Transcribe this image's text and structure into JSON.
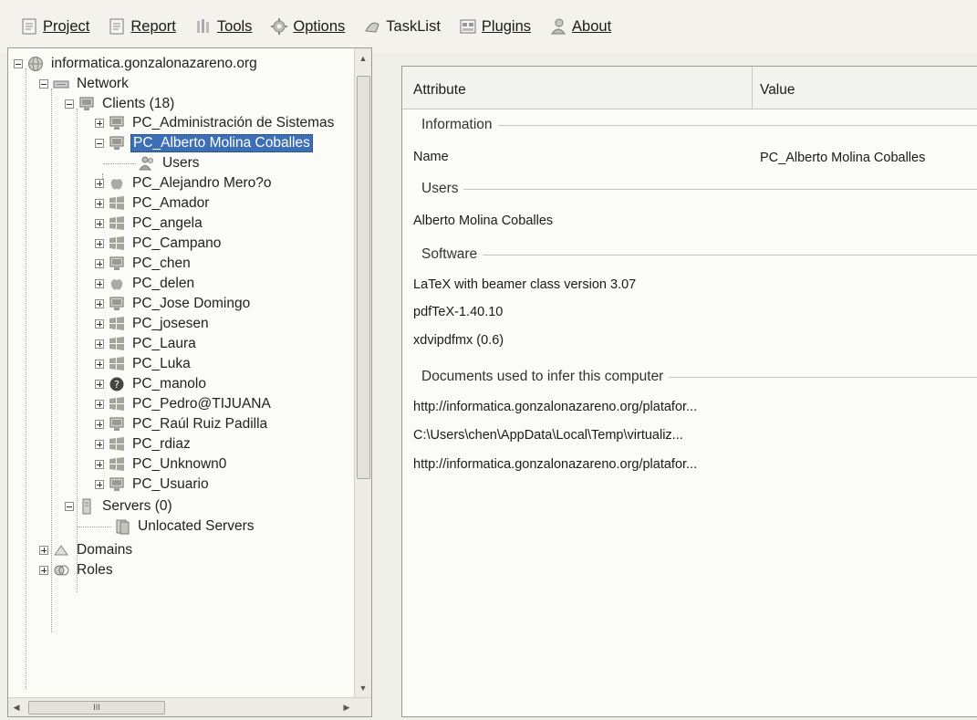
{
  "menu": [
    {
      "label": "Project",
      "icon": "document-icon"
    },
    {
      "label": "Report",
      "icon": "report-icon"
    },
    {
      "label": "Tools",
      "icon": "tools-icon"
    },
    {
      "label": "Options",
      "icon": "gear-icon"
    },
    {
      "label": "TaskList",
      "icon": "tasklist-icon"
    },
    {
      "label": "Plugins",
      "icon": "plugin-icon"
    },
    {
      "label": "About",
      "icon": "about-icon"
    }
  ],
  "tree": {
    "root": "informatica.gonzalonazareno.org",
    "network": "Network",
    "clients": "Clients (18)",
    "client_items": [
      "PC_Administración de Sistemas",
      "PC_Alberto Molina Coballes",
      "Users",
      "PC_Alejandro Mero?o",
      "PC_Amador",
      "PC_angela",
      "PC_Campano",
      "PC_chen",
      "PC_delen",
      "PC_Jose Domingo",
      "PC_josesen",
      "PC_Laura",
      "PC_Luka",
      "PC_manolo",
      "PC_Pedro@TIJUANA",
      "PC_Raúl Ruiz Padilla",
      "PC_rdiaz",
      "PC_Unknown0",
      "PC_Usuario"
    ],
    "servers": "Servers (0)",
    "unlocated": "Unlocated Servers",
    "domains": "Domains",
    "roles": "Roles",
    "scroll_glyph": "III"
  },
  "details": {
    "col_attribute": "Attribute",
    "col_value": "Value",
    "group_information": "Information",
    "name_label": "Name",
    "name_value": "PC_Alberto Molina Coballes",
    "group_users": "Users",
    "user_1": "Alberto Molina Coballes",
    "group_software": "Software",
    "software": [
      "LaTeX with beamer class version 3.07",
      "pdfTeX-1.40.10",
      "xdvipdfmx (0.6)"
    ],
    "group_documents": "Documents used to infer this computer",
    "documents": [
      "http://informatica.gonzalonazareno.org/platafor...",
      "C:\\Users\\chen\\AppData\\Local\\Temp\\virtualiz...",
      "http://informatica.gonzalonazareno.org/platafor..."
    ]
  },
  "colors": {
    "selection": "#3d6fb6",
    "window_bg": "#efefea",
    "panel_bg": "#fbfbf8"
  }
}
